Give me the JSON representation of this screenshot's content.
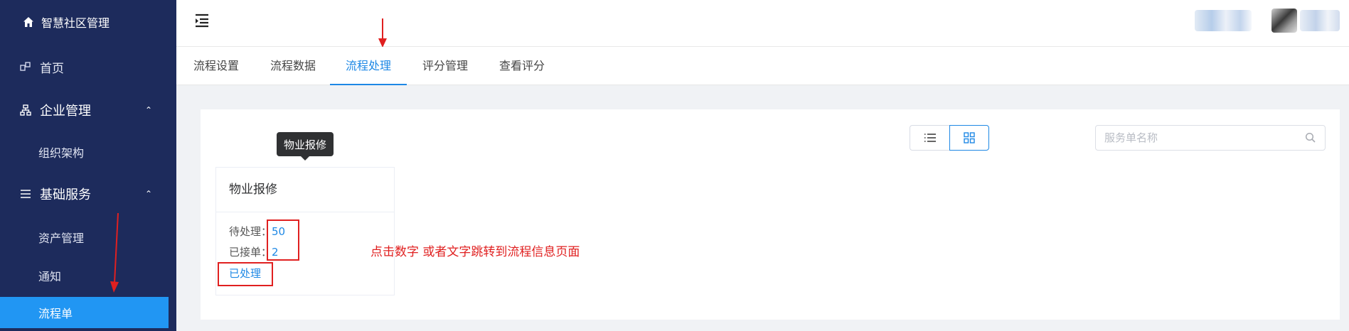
{
  "sidebar": {
    "brand": "智慧社区管理",
    "home": "首页",
    "enterprise": "企业管理",
    "org": "组织架构",
    "basic": "基础服务",
    "items": [
      "资产管理",
      "通知",
      "流程单"
    ]
  },
  "tabs": [
    "流程设置",
    "流程数据",
    "流程处理",
    "评分管理",
    "查看评分"
  ],
  "search": {
    "placeholder": "服务单名称"
  },
  "tooltip": "物业报修",
  "card": {
    "title": "物业报修",
    "pending_label": "待处理：",
    "pending_value": "50",
    "accepted_label": "已接单：",
    "accepted_value": "2",
    "done_link": "已处理"
  },
  "annotation": "点击数字 或者文字跳转到流程信息页面",
  "colors": {
    "sidebar": "#1d2b5c",
    "accent": "#1e88e5",
    "active_item": "#2196f3",
    "annotation": "#e02020"
  }
}
